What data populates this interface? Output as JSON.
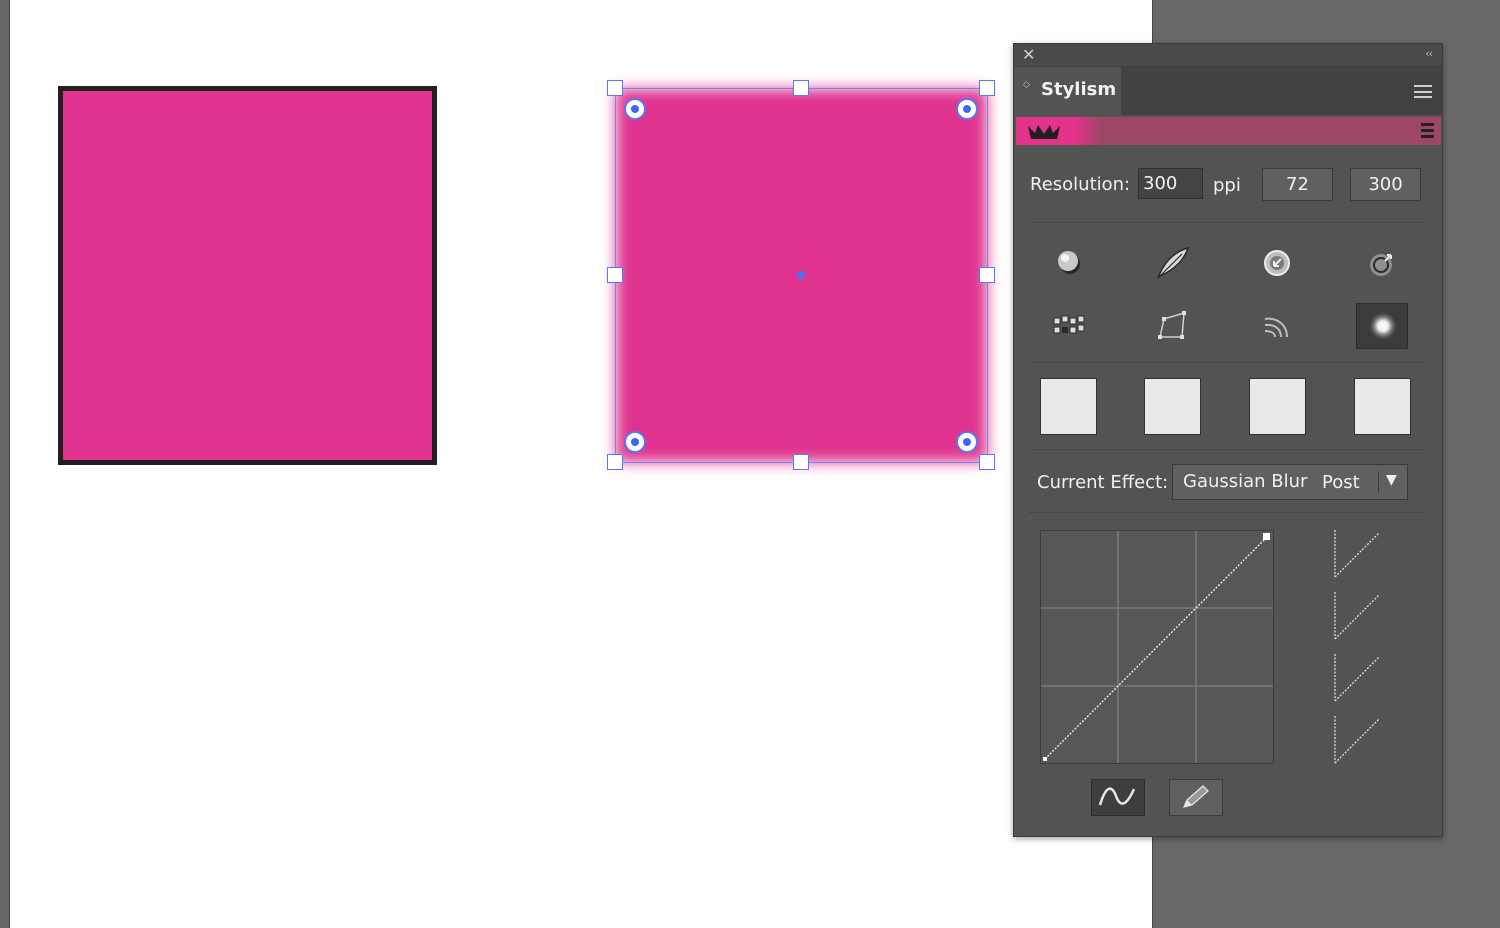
{
  "canvas": {
    "fill_color": "#e0338f",
    "stroke_color": "#231f20",
    "selection_color": "#5a78ee"
  },
  "panel": {
    "tab_label": "Stylism",
    "resolution": {
      "label": "Resolution:",
      "value": "300",
      "unit": "ppi",
      "presets": [
        "72",
        "300"
      ]
    },
    "tools_row1": [
      "sphere-icon",
      "feather-icon",
      "inner-glow-icon",
      "outer-glow-icon"
    ],
    "tools_row2": [
      "pixelate-icon",
      "distort-icon",
      "ripple-icon",
      "blur-icon"
    ],
    "active_tool": "blur-icon",
    "current_effect": {
      "label": "Current Effect:",
      "name": "Gaussian Blur",
      "mode": "Post"
    },
    "accent_color": "#e3338a",
    "brand_bar_color": "#9e4668"
  }
}
